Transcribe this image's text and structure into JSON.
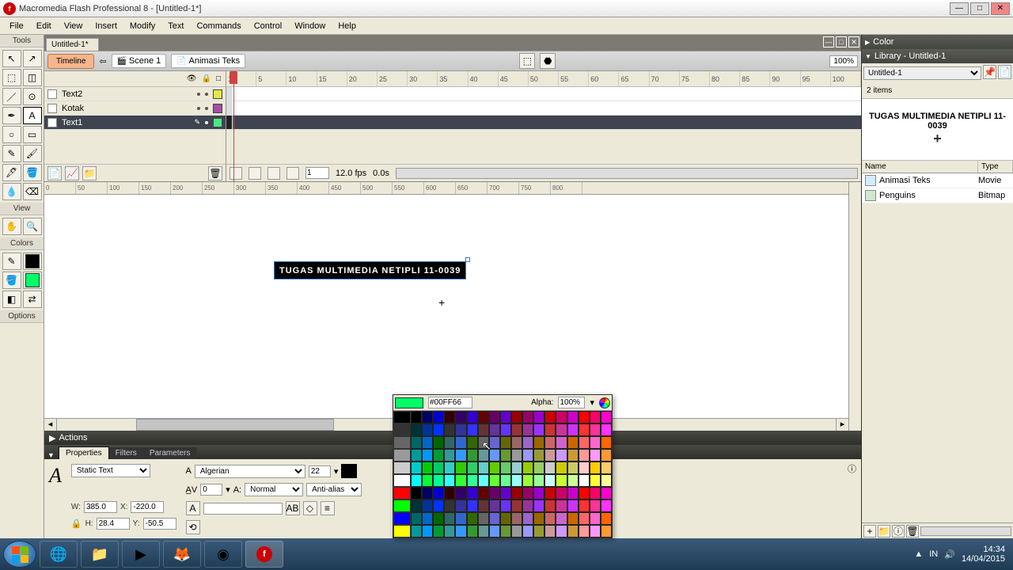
{
  "titlebar": {
    "title": "Macromedia Flash Professional 8 - [Untitled-1*]"
  },
  "menu": [
    "File",
    "Edit",
    "View",
    "Insert",
    "Modify",
    "Text",
    "Commands",
    "Control",
    "Window",
    "Help"
  ],
  "tools": {
    "title": "Tools",
    "view": "View",
    "colors": "Colors",
    "options": "Options"
  },
  "doc": {
    "tab": "Untitled-1*"
  },
  "sceneBar": {
    "timeline": "Timeline",
    "scene": "Scene 1",
    "clip": "Animasi Teks",
    "zoom": "100%"
  },
  "layers": [
    {
      "name": "Text2",
      "color": "#e6e64d"
    },
    {
      "name": "Kotak",
      "color": "#a64da6"
    },
    {
      "name": "Text1",
      "color": "#4de68a"
    }
  ],
  "frameFooter": {
    "frame": "1",
    "fps": "12.0 fps",
    "time": "0.0s"
  },
  "stage": {
    "text": "TUGAS MULTIMEDIA NETIPLI 11-0039"
  },
  "actions": {
    "title": "Actions"
  },
  "propsTabs": [
    "Properties",
    "Filters",
    "Parameters"
  ],
  "props": {
    "type": "Static Text",
    "font": "Algerian",
    "size": "22",
    "av": "0",
    "kind": "Normal",
    "antialias": "Anti-alias for re",
    "w": "385.0",
    "h": "28.4",
    "x": "-220.0",
    "y": "-50.5"
  },
  "colorPicker": {
    "current": "#00FF66",
    "alphaLabel": "Alpha:",
    "alpha": "100%"
  },
  "rightPanels": {
    "color": "Color",
    "library": "Library - Untitled-1",
    "libDoc": "Untitled-1",
    "count": "2 items",
    "preview": "TUGAS MULTIMEDIA NETIPLI 11-0039",
    "nameCol": "Name",
    "typeCol": "Type",
    "items": [
      {
        "name": "Animasi Teks",
        "type": "Movie"
      },
      {
        "name": "Penguins",
        "type": "Bitmap"
      }
    ]
  },
  "taskbar": {
    "lang": "IN",
    "time": "14:34",
    "date": "14/04/2015"
  },
  "ruler": [
    "1",
    "5",
    "10",
    "15",
    "20",
    "25",
    "30",
    "35",
    "40",
    "45",
    "50",
    "55",
    "60",
    "65",
    "70",
    "75",
    "80",
    "85",
    "90",
    "95",
    "100"
  ],
  "stageRuler": [
    "0",
    "50",
    "100",
    "150",
    "200",
    "250",
    "300",
    "350",
    "400",
    "450",
    "500",
    "550",
    "600",
    "650",
    "700",
    "750",
    "800"
  ]
}
